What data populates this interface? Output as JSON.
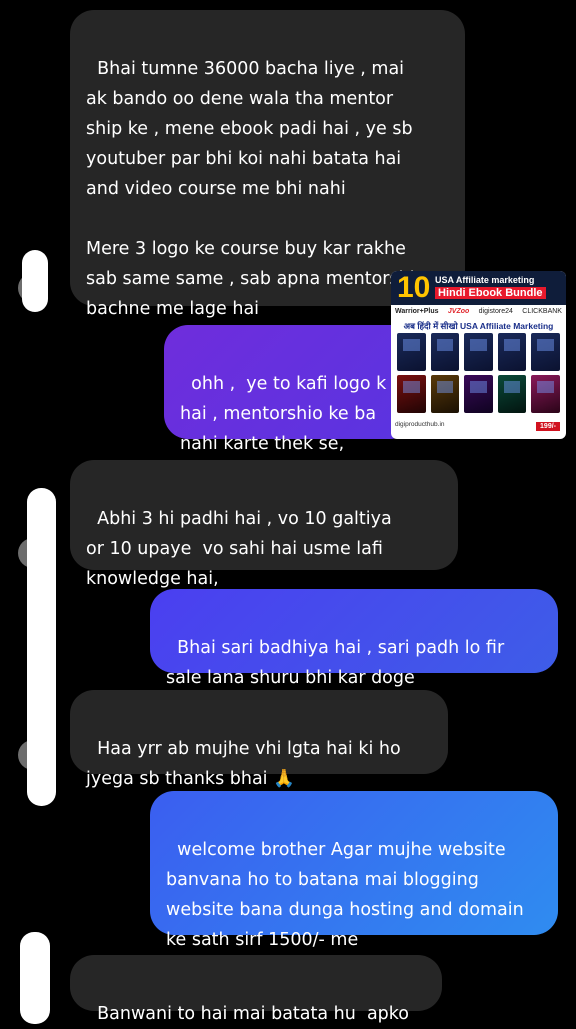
{
  "messages": [
    {
      "side": "in",
      "text": "Bhai tumne 36000 bacha liye , mai\nak bando oo dene wala tha mentor\nship ke , mene ebook padi hai , ye sb\nyoutuber par bhi koi nahi batata hai\nand video course me bhi nahi\n\nMere 3 logo ke course buy kar rakhe\nsab same same , sab apna mentorship\nbachne me lage hai"
    },
    {
      "side": "out",
      "text": "ohh ,  ye to kafi logo k\nhai , mentorshio ke ba\nnahi karte thek se,"
    },
    {
      "side": "in",
      "text": "Abhi 3 hi padhi hai , vo 10 galtiya\nor 10 upaye  vo sahi hai usme lafi\nknowledge hai,"
    },
    {
      "side": "out",
      "text": "Bhai sari badhiya hai , sari padh lo fir\nsale lana shuru bhi kar doge"
    },
    {
      "side": "in",
      "text": "Haa yrr ab mujhe vhi lgta hai ki ho\njyega sb thanks bhai 🙏"
    },
    {
      "side": "out",
      "text": "welcome brother Agar mujhe website\nbanvana ho to batana mai blogging\nwebsite bana dunga hosting and domain\nke sath sirf 1500/- me"
    },
    {
      "side": "in",
      "text": "Banwani to hai mai batata hu  apko"
    }
  ],
  "ad": {
    "number": "10",
    "line1": "USA Affiliate marketing",
    "line2": "Hindi Ebook Bundle",
    "logos": [
      "Warrior+Plus",
      "JVZoo",
      "digistore24",
      "CLICKBANK"
    ],
    "subtitle": "अब हिंदी में सीखो USA Affiliate Marketing",
    "footer": "digiproducthub.in",
    "price": "199/-"
  }
}
